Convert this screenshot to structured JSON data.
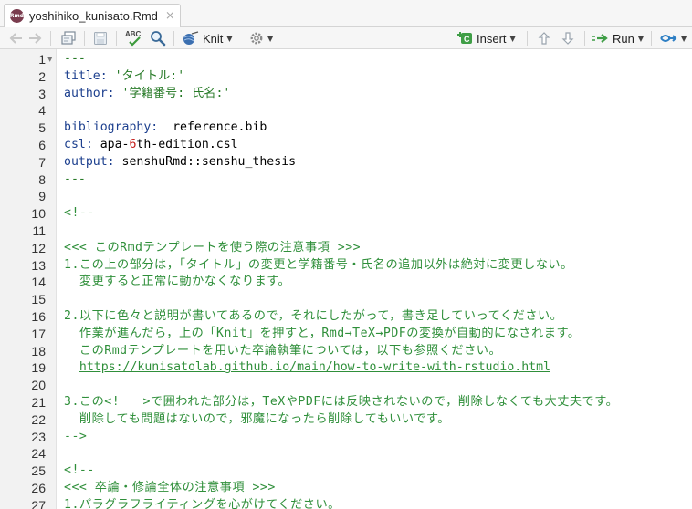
{
  "tab": {
    "filename": "yoshihiko_kunisato.Rmd",
    "close_glyph": "×"
  },
  "toolbar": {
    "knit_label": "Knit",
    "insert_label": "Insert",
    "run_label": "Run",
    "spell_label": "ABC"
  },
  "editor": {
    "lines": [
      {
        "n": "1",
        "parts": [
          {
            "t": "---",
            "c": "str"
          }
        ],
        "fold": true
      },
      {
        "n": "2",
        "parts": [
          {
            "t": "title:",
            "c": "key"
          },
          {
            "t": " 'タイトル:'",
            "c": "str"
          }
        ]
      },
      {
        "n": "3",
        "parts": [
          {
            "t": "author:",
            "c": "key"
          },
          {
            "t": " '学籍番号: 氏名:'",
            "c": "str"
          }
        ]
      },
      {
        "n": "4",
        "parts": []
      },
      {
        "n": "5",
        "parts": [
          {
            "t": "bibliography:",
            "c": "key"
          },
          {
            "t": "  reference.bib",
            "c": ""
          }
        ]
      },
      {
        "n": "6",
        "parts": [
          {
            "t": "csl:",
            "c": "key"
          },
          {
            "t": " apa-",
            "c": ""
          },
          {
            "t": "6",
            "c": "num-red"
          },
          {
            "t": "th-edition.csl",
            "c": ""
          }
        ]
      },
      {
        "n": "7",
        "parts": [
          {
            "t": "output:",
            "c": "key"
          },
          {
            "t": " senshuRmd::senshu_thesis",
            "c": ""
          }
        ]
      },
      {
        "n": "8",
        "parts": [
          {
            "t": "---",
            "c": "str"
          }
        ]
      },
      {
        "n": "9",
        "parts": []
      },
      {
        "n": "10",
        "parts": [
          {
            "t": "<!--",
            "c": "cm"
          }
        ]
      },
      {
        "n": "11",
        "parts": []
      },
      {
        "n": "12",
        "parts": [
          {
            "t": "<<< このRmdテンプレートを使う際の注意事項 >>>",
            "c": "cm"
          }
        ]
      },
      {
        "n": "13",
        "parts": [
          {
            "t": "1.この上の部分は，「タイトル」の変更と学籍番号・氏名の追加以外は絶対に変更しない。",
            "c": "cm"
          }
        ]
      },
      {
        "n": "14",
        "parts": [
          {
            "t": "  変更すると正常に動かなくなります。",
            "c": "cm"
          }
        ]
      },
      {
        "n": "15",
        "parts": []
      },
      {
        "n": "16",
        "parts": [
          {
            "t": "2.以下に色々と説明が書いてあるので，それにしたがって，書き足していってください。",
            "c": "cm"
          }
        ]
      },
      {
        "n": "17",
        "parts": [
          {
            "t": "  作業が進んだら，上の「Knit」を押すと，Rmd→TeX→PDFの変換が自動的になされます。",
            "c": "cm"
          }
        ]
      },
      {
        "n": "18",
        "parts": [
          {
            "t": "  このRmdテンプレートを用いた卒論執筆については，以下も参照ください。",
            "c": "cm"
          }
        ]
      },
      {
        "n": "19",
        "parts": [
          {
            "t": "  ",
            "c": "cm"
          },
          {
            "t": "https://kunisatolab.github.io/main/how-to-write-with-rstudio.html",
            "c": "link"
          }
        ]
      },
      {
        "n": "20",
        "parts": []
      },
      {
        "n": "21",
        "parts": [
          {
            "t": "3.この<!   >で囲われた部分は，TeXやPDFには反映されないので，削除しなくても大丈夫です。",
            "c": "cm"
          }
        ]
      },
      {
        "n": "22",
        "parts": [
          {
            "t": "  削除しても問題はないので，邪魔になったら削除してもいいです。",
            "c": "cm"
          }
        ]
      },
      {
        "n": "23",
        "parts": [
          {
            "t": "-->",
            "c": "cm"
          }
        ]
      },
      {
        "n": "24",
        "parts": []
      },
      {
        "n": "25",
        "parts": [
          {
            "t": "<!--",
            "c": "cm"
          }
        ]
      },
      {
        "n": "26",
        "parts": [
          {
            "t": "<<< 卒論・修論全体の注意事項 >>>",
            "c": "cm"
          }
        ]
      },
      {
        "n": "27",
        "parts": [
          {
            "t": "1.パラグラフライティングを心がけてください。",
            "c": "cm"
          }
        ]
      }
    ]
  },
  "colors": {
    "yaml_key": "#1c3f8e",
    "string": "#277a27",
    "comment": "#2f8f3a",
    "number": "#c41a16"
  }
}
